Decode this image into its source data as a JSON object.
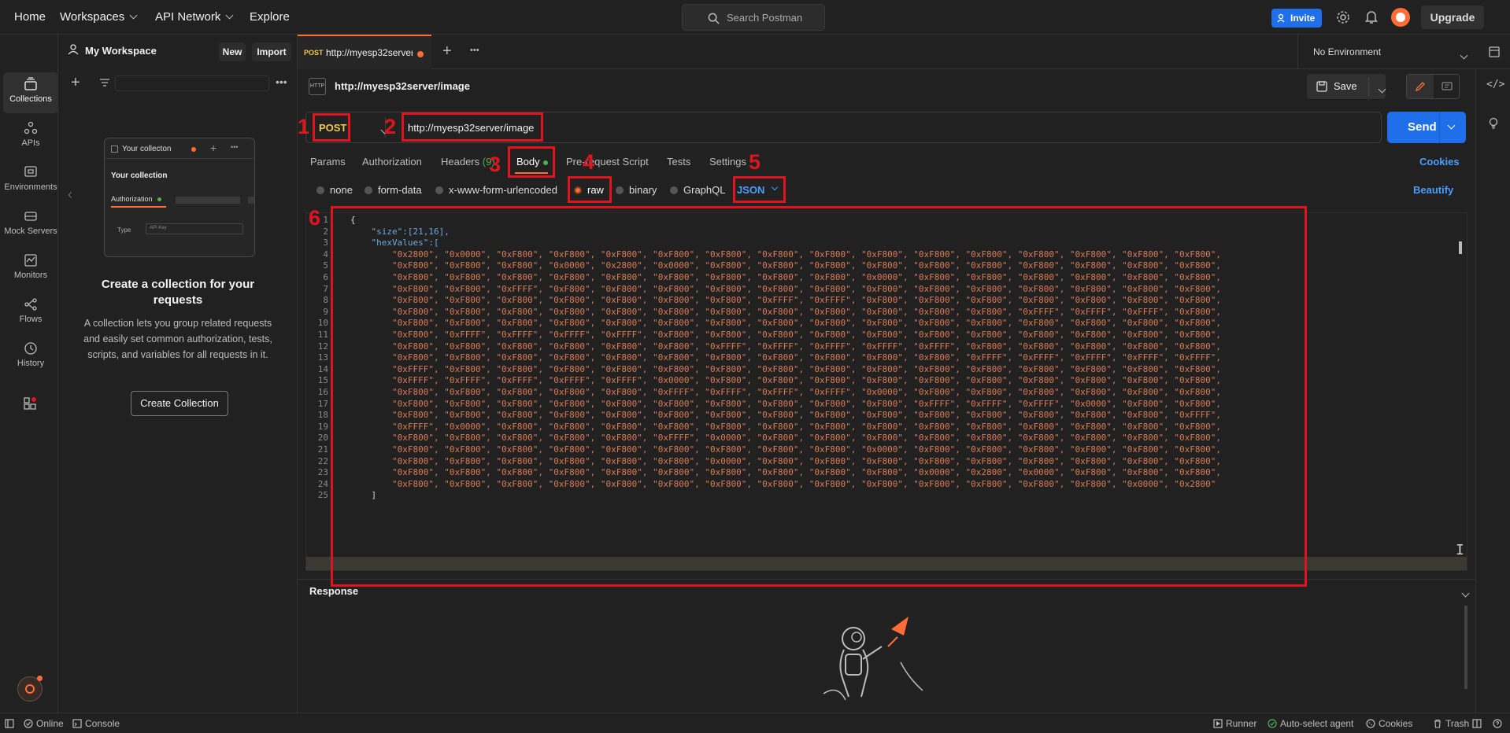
{
  "topbar": {
    "home": "Home",
    "workspaces": "Workspaces",
    "api_network": "API Network",
    "explore": "Explore",
    "search_placeholder": "Search Postman",
    "invite": "Invite",
    "upgrade": "Upgrade"
  },
  "workspace": {
    "title": "My Workspace",
    "new": "New",
    "import": "Import"
  },
  "rail": [
    {
      "label": "Collections",
      "icon": "collections-icon"
    },
    {
      "label": "APIs",
      "icon": "apis-icon"
    },
    {
      "label": "Environments",
      "icon": "environments-icon"
    },
    {
      "label": "Mock Servers",
      "icon": "mock-servers-icon"
    },
    {
      "label": "Monitors",
      "icon": "monitors-icon"
    },
    {
      "label": "Flows",
      "icon": "flows-icon"
    },
    {
      "label": "History",
      "icon": "history-icon"
    }
  ],
  "empty_state": {
    "card_title": "Your collecton",
    "card_heading": "Your collection",
    "card_tab": "Authorization",
    "card_type": "Type",
    "card_type_value": "API Key",
    "heading": "Create a collection for your requests",
    "body": "A collection lets you group related requests and easily set common authorization, tests, scripts, and variables for all requests in it.",
    "button": "Create Collection"
  },
  "request_tab": {
    "method": "POST",
    "title": "http://myesp32server"
  },
  "environment": "No Environment",
  "request": {
    "name": "http://myesp32server/image",
    "save": "Save",
    "method": "POST",
    "url": "http://myesp32server/image",
    "send": "Send"
  },
  "req_tabs": {
    "params": "Params",
    "authorization": "Authorization",
    "headers": "Headers",
    "headers_count": "(9)",
    "body": "Body",
    "pre_request": "Pre-request Script",
    "tests": "Tests",
    "settings": "Settings",
    "cookies": "Cookies"
  },
  "body_types": {
    "none": "none",
    "form_data": "form-data",
    "urlencoded": "x-www-form-urlencoded",
    "raw": "raw",
    "binary": "binary",
    "graphql": "GraphQL",
    "format": "JSON",
    "beautify": "Beautify"
  },
  "annotations": [
    "1",
    "2",
    "3",
    "4",
    "5",
    "6"
  ],
  "editor": {
    "line_numbers": [
      "1",
      "2",
      "3",
      "4",
      "5",
      "6",
      "7",
      "8",
      "9",
      "10",
      "11",
      "12",
      "13",
      "14",
      "15",
      "16",
      "17",
      "18",
      "19",
      "20",
      "21",
      "22",
      "23",
      "24",
      "25"
    ],
    "lines": [
      "{",
      "    \"size\":[21,16],",
      "    \"hexValues\":[",
      "        \"0x2800\", \"0x0000\", \"0xF800\", \"0xF800\", \"0xF800\", \"0xF800\", \"0xF800\", \"0xF800\", \"0xF800\", \"0xF800\", \"0xF800\", \"0xF800\", \"0xF800\", \"0xF800\", \"0xF800\", \"0xF800\",",
      "        \"0xF800\", \"0xF800\", \"0xF800\", \"0x0000\", \"0x2800\", \"0x0000\", \"0xF800\", \"0xF800\", \"0xF800\", \"0xF800\", \"0xF800\", \"0xF800\", \"0xF800\", \"0xF800\", \"0xF800\", \"0xF800\",",
      "        \"0xF800\", \"0xF800\", \"0xF800\", \"0xF800\", \"0xF800\", \"0xF800\", \"0xF800\", \"0xF800\", \"0xF800\", \"0x0000\", \"0xF800\", \"0xF800\", \"0xF800\", \"0xF800\", \"0xF800\", \"0xF800\",",
      "        \"0xF800\", \"0xF800\", \"0xFFFF\", \"0xF800\", \"0xF800\", \"0xF800\", \"0xF800\", \"0xF800\", \"0xF800\", \"0xF800\", \"0xF800\", \"0xF800\", \"0xF800\", \"0xF800\", \"0xF800\", \"0xF800\",",
      "        \"0xF800\", \"0xF800\", \"0xF800\", \"0xF800\", \"0xF800\", \"0xF800\", \"0xF800\", \"0xFFFF\", \"0xFFFF\", \"0xF800\", \"0xF800\", \"0xF800\", \"0xF800\", \"0xF800\", \"0xF800\", \"0xF800\",",
      "        \"0xF800\", \"0xF800\", \"0xF800\", \"0xF800\", \"0xF800\", \"0xF800\", \"0xF800\", \"0xF800\", \"0xF800\", \"0xF800\", \"0xF800\", \"0xF800\", \"0xFFFF\", \"0xFFFF\", \"0xFFFF\", \"0xF800\",",
      "        \"0xF800\", \"0xF800\", \"0xF800\", \"0xF800\", \"0xF800\", \"0xF800\", \"0xF800\", \"0xF800\", \"0xF800\", \"0xF800\", \"0xF800\", \"0xF800\", \"0xF800\", \"0xF800\", \"0xF800\", \"0xF800\",",
      "        \"0xF800\", \"0xFFFF\", \"0xFFFF\", \"0xFFFF\", \"0xFFFF\", \"0xF800\", \"0xF800\", \"0xF800\", \"0xF800\", \"0xF800\", \"0xF800\", \"0xF800\", \"0xF800\", \"0xF800\", \"0xF800\", \"0xF800\",",
      "        \"0xF800\", \"0xF800\", \"0xF800\", \"0xF800\", \"0xF800\", \"0xF800\", \"0xFFFF\", \"0xFFFF\", \"0xFFFF\", \"0xFFFF\", \"0xFFFF\", \"0xF800\", \"0xF800\", \"0xF800\", \"0xF800\", \"0xF800\",",
      "        \"0xF800\", \"0xF800\", \"0xF800\", \"0xF800\", \"0xF800\", \"0xF800\", \"0xF800\", \"0xF800\", \"0xF800\", \"0xF800\", \"0xF800\", \"0xFFFF\", \"0xFFFF\", \"0xFFFF\", \"0xFFFF\", \"0xFFFF\",",
      "        \"0xFFFF\", \"0xF800\", \"0xF800\", \"0xF800\", \"0xF800\", \"0xF800\", \"0xF800\", \"0xF800\", \"0xF800\", \"0xF800\", \"0xF800\", \"0xF800\", \"0xF800\", \"0xF800\", \"0xF800\", \"0xF800\",",
      "        \"0xFFFF\", \"0xFFFF\", \"0xFFFF\", \"0xFFFF\", \"0xFFFF\", \"0x0000\", \"0xF800\", \"0xF800\", \"0xF800\", \"0xF800\", \"0xF800\", \"0xF800\", \"0xF800\", \"0xF800\", \"0xF800\", \"0xF800\",",
      "        \"0xF800\", \"0xF800\", \"0xF800\", \"0xF800\", \"0xF800\", \"0xFFFF\", \"0xFFFF\", \"0xFFFF\", \"0xFFFF\", \"0x0000\", \"0xF800\", \"0xF800\", \"0xF800\", \"0xF800\", \"0xF800\", \"0xF800\",",
      "        \"0xF800\", \"0xF800\", \"0xF800\", \"0xF800\", \"0xF800\", \"0xF800\", \"0xF800\", \"0xF800\", \"0xF800\", \"0xF800\", \"0xFFFF\", \"0xFFFF\", \"0xFFFF\", \"0x0000\", \"0xF800\", \"0xF800\",",
      "        \"0xF800\", \"0xF800\", \"0xF800\", \"0xF800\", \"0xF800\", \"0xF800\", \"0xF800\", \"0xF800\", \"0xF800\", \"0xF800\", \"0xF800\", \"0xF800\", \"0xF800\", \"0xF800\", \"0xF800\", \"0xFFFF\",",
      "        \"0xFFFF\", \"0x0000\", \"0xF800\", \"0xF800\", \"0xF800\", \"0xF800\", \"0xF800\", \"0xF800\", \"0xF800\", \"0xF800\", \"0xF800\", \"0xF800\", \"0xF800\", \"0xF800\", \"0xF800\", \"0xF800\",",
      "        \"0xF800\", \"0xF800\", \"0xF800\", \"0xF800\", \"0xF800\", \"0xFFFF\", \"0x0000\", \"0xF800\", \"0xF800\", \"0xF800\", \"0xF800\", \"0xF800\", \"0xF800\", \"0xF800\", \"0xF800\", \"0xF800\",",
      "        \"0xF800\", \"0xF800\", \"0xF800\", \"0xF800\", \"0xF800\", \"0xF800\", \"0xF800\", \"0xF800\", \"0xF800\", \"0x0000\", \"0xF800\", \"0xF800\", \"0xF800\", \"0xF800\", \"0xF800\", \"0xF800\",",
      "        \"0xF800\", \"0xF800\", \"0xF800\", \"0xF800\", \"0xF800\", \"0xF800\", \"0x0000\", \"0xF800\", \"0xF800\", \"0xF800\", \"0xF800\", \"0xF800\", \"0xF800\", \"0xF800\", \"0xF800\", \"0xF800\",",
      "        \"0xF800\", \"0xF800\", \"0xF800\", \"0xF800\", \"0xF800\", \"0xF800\", \"0xF800\", \"0xF800\", \"0xF800\", \"0xF800\", \"0x0000\", \"0x2800\", \"0x0000\", \"0xF800\", \"0xF800\", \"0xF800\",",
      "        \"0xF800\", \"0xF800\", \"0xF800\", \"0xF800\", \"0xF800\", \"0xF800\", \"0xF800\", \"0xF800\", \"0xF800\", \"0xF800\", \"0xF800\", \"0xF800\", \"0xF800\", \"0xF800\", \"0x0000\", \"0x2800\"",
      "    ]"
    ]
  },
  "response": {
    "title": "Response"
  },
  "statusbar": {
    "online": "Online",
    "console": "Console",
    "runner": "Runner",
    "agent": "Auto-select agent",
    "cookies": "Cookies",
    "trash": "Trash"
  },
  "colors": {
    "accent": "#1f6feb",
    "annotation": "#e0141e",
    "brand": "#ff6c37",
    "method": "#f2c94c"
  }
}
